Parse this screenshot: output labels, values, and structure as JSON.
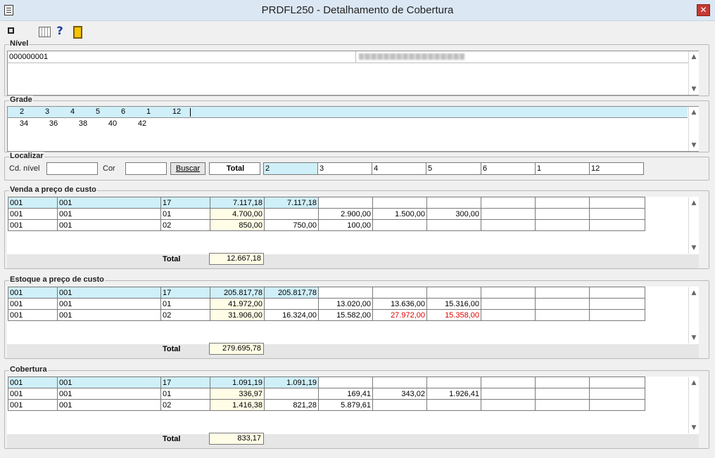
{
  "window": {
    "title": "PRDFL250 - Detalhamento de Cobertura",
    "close_label": "✕"
  },
  "toolbar": {
    "help_label": "?"
  },
  "nivel": {
    "label": "Nível",
    "code": "000000001"
  },
  "grade": {
    "label": "Grade",
    "row1": [
      "2",
      "3",
      "4",
      "5",
      "6",
      "1",
      "12"
    ],
    "row2": [
      "34",
      "36",
      "38",
      "40",
      "42"
    ]
  },
  "localizar": {
    "label": "Localizar",
    "cd_nivel_label": "Cd. nível",
    "cd_nivel_value": "",
    "cor_label": "Cor",
    "cor_value": "",
    "buscar_label": "Buscar",
    "total_label": "Total",
    "sizes": [
      "2",
      "3",
      "4",
      "5",
      "6",
      "1",
      "12"
    ]
  },
  "venda": {
    "label": "Venda a preço de custo",
    "rows": [
      [
        "001",
        "001",
        "17",
        "7.117,18",
        "7.117,18",
        "",
        "",
        "",
        "",
        "",
        ""
      ],
      [
        "001",
        "001",
        "01",
        "4.700,00",
        "",
        "2.900,00",
        "1.500,00",
        "300,00",
        "",
        "",
        ""
      ],
      [
        "001",
        "001",
        "02",
        "850,00",
        "750,00",
        "100,00",
        "",
        "",
        "",
        "",
        ""
      ]
    ],
    "total_label": "Total",
    "total_value": "12.667,18"
  },
  "estoque": {
    "label": "Estoque a preço de custo",
    "rows": [
      [
        "001",
        "001",
        "17",
        "205.817,78",
        "205.817,78",
        "",
        "",
        "",
        "",
        "",
        ""
      ],
      [
        "001",
        "001",
        "01",
        "41.972,00",
        "",
        "13.020,00",
        "13.636,00",
        "15.316,00",
        "",
        "",
        ""
      ],
      [
        "001",
        "001",
        "02",
        "31.906,00",
        "16.324,00",
        "15.582,00",
        "27.972,00",
        "15.358,00",
        "",
        "",
        ""
      ]
    ],
    "negative_color": "#e00000",
    "total_label": "Total",
    "total_value": "279.695,78"
  },
  "cobertura": {
    "label": "Cobertura",
    "rows": [
      [
        "001",
        "001",
        "17",
        "1.091,19",
        "1.091,19",
        "",
        "",
        "",
        "",
        "",
        ""
      ],
      [
        "001",
        "001",
        "01",
        "336,97",
        "",
        "169,41",
        "343,02",
        "1.926,41",
        "",
        "",
        ""
      ],
      [
        "001",
        "001",
        "02",
        "1.416,38",
        "821,28",
        "5.879,61",
        "",
        "",
        "",
        "",
        ""
      ]
    ],
    "total_label": "Total",
    "total_value": "833,17"
  },
  "colors": {
    "highlight": "#cfeff9",
    "total_column": "#fffde6",
    "titlebar": "#dbe7f3"
  }
}
